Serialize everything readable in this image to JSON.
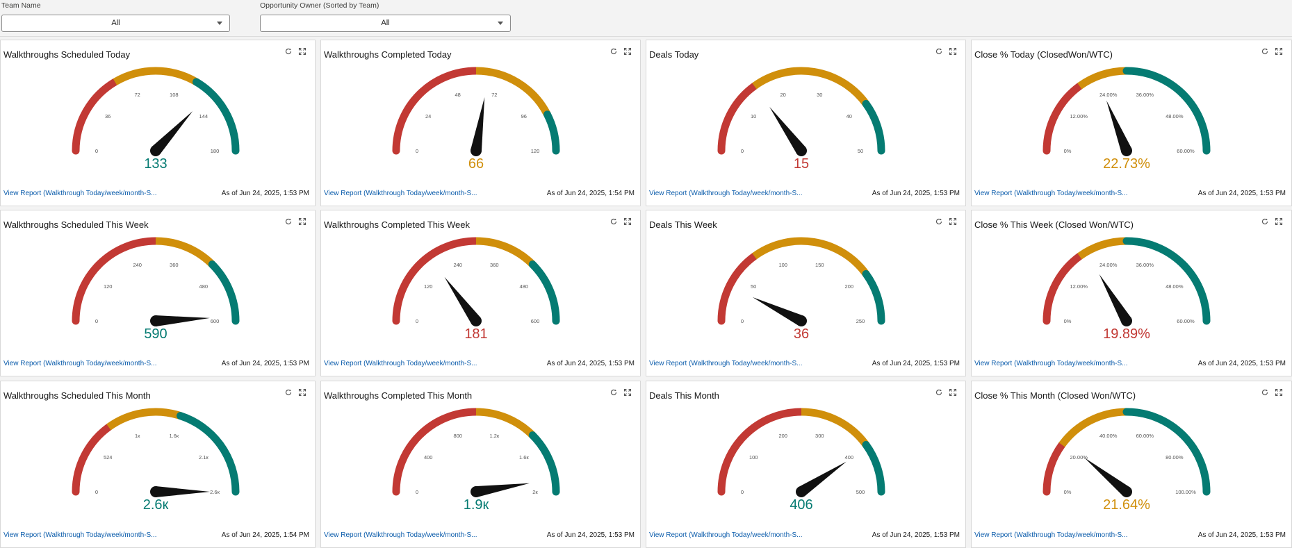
{
  "filters": [
    {
      "label": "Team Name",
      "value": "All"
    },
    {
      "label": "Opportunity Owner (Sorted by Team)",
      "value": "All"
    }
  ],
  "colors": {
    "red": "#c23934",
    "amber": "#d08f0b",
    "teal": "#057b72",
    "link": "#0b5cab"
  },
  "icons": {
    "refresh": "refresh-icon",
    "expand": "expand-icon"
  },
  "cards": [
    {
      "title": "Walkthroughs Scheduled Today",
      "value_label": "133",
      "value": 133,
      "min": 0,
      "max": 180,
      "ticks": [
        "0",
        "36",
        "72",
        "108",
        "144",
        "180"
      ],
      "breaks": [
        0.33,
        0.67
      ],
      "value_color": "#057b72",
      "link": "View Report (Walkthrough Today/week/month-S...",
      "asof": "As of Jun 24, 2025, 1:53 PM"
    },
    {
      "title": "Walkthroughs Completed Today",
      "value_label": "66",
      "value": 66,
      "min": 0,
      "max": 120,
      "ticks": [
        "0",
        "24",
        "48",
        "72",
        "96",
        "120"
      ],
      "breaks": [
        0.5,
        0.85
      ],
      "value_color": "#d08f0b",
      "link": "View Report (Walkthrough Today/week/month-S...",
      "asof": "As of Jun 24, 2025, 1:54 PM"
    },
    {
      "title": "Deals Today",
      "value_label": "15",
      "value": 15,
      "min": 0,
      "max": 50,
      "ticks": [
        "0",
        "10",
        "20",
        "30",
        "40",
        "50"
      ],
      "breaks": [
        0.3,
        0.8
      ],
      "value_color": "#c23934",
      "link": "View Report (Walkthrough Today/week/month-S...",
      "asof": "As of Jun 24, 2025, 1:53 PM"
    },
    {
      "title": "Close % Today (ClosedWon/WTC)",
      "value_label": "22.73%",
      "value": 22.73,
      "min": 0,
      "max": 60,
      "ticks": [
        "0%",
        "12.00%",
        "24.00%",
        "36.00%",
        "48.00%",
        "60.00%"
      ],
      "breaks": [
        0.3,
        0.5
      ],
      "value_color": "#d08f0b",
      "link": "View Report (Walkthrough Today/week/month-S...",
      "asof": "As of Jun 24, 2025, 1:53 PM"
    },
    {
      "title": "Walkthroughs Scheduled This Week",
      "value_label": "590",
      "value": 590,
      "min": 0,
      "max": 600,
      "ticks": [
        "0",
        "120",
        "240",
        "360",
        "480",
        "600"
      ],
      "breaks": [
        0.5,
        0.75
      ],
      "value_color": "#057b72",
      "link": "View Report (Walkthrough Today/week/month-S...",
      "asof": "As of Jun 24, 2025, 1:53 PM"
    },
    {
      "title": "Walkthroughs Completed This Week",
      "value_label": "181",
      "value": 181,
      "min": 0,
      "max": 600,
      "ticks": [
        "0",
        "120",
        "240",
        "360",
        "480",
        "600"
      ],
      "breaks": [
        0.5,
        0.75
      ],
      "value_color": "#c23934",
      "link": "View Report (Walkthrough Today/week/month-S...",
      "asof": "As of Jun 24, 2025, 1:53 PM"
    },
    {
      "title": "Deals This Week",
      "value_label": "36",
      "value": 36,
      "min": 0,
      "max": 250,
      "ticks": [
        "0",
        "50",
        "100",
        "150",
        "200",
        "250"
      ],
      "breaks": [
        0.3,
        0.8
      ],
      "value_color": "#c23934",
      "link": "View Report (Walkthrough Today/week/month-S...",
      "asof": "As of Jun 24, 2025, 1:53 PM"
    },
    {
      "title": "Close % This Week (Closed Won/WTC)",
      "value_label": "19.89%",
      "value": 19.89,
      "min": 0,
      "max": 60,
      "ticks": [
        "0%",
        "12.00%",
        "24.00%",
        "36.00%",
        "48.00%",
        "60.00%"
      ],
      "breaks": [
        0.3,
        0.5
      ],
      "value_color": "#c23934",
      "link": "View Report (Walkthrough Today/week/month-S...",
      "asof": "As of Jun 24, 2025, 1:53 PM"
    },
    {
      "title": "Walkthroughs Scheduled This Month",
      "value_label": "2.6к",
      "value": 2600,
      "min": 0,
      "max": 2600,
      "ticks": [
        "0",
        "524",
        "1к",
        "1.6к",
        "2.1к",
        "2.6к"
      ],
      "breaks": [
        0.3,
        0.6
      ],
      "value_color": "#057b72",
      "link": "View Report (Walkthrough Today/week/month-S...",
      "asof": "As of Jun 24, 2025, 1:54 PM"
    },
    {
      "title": "Walkthroughs Completed This Month",
      "value_label": "1.9к",
      "value": 1900,
      "min": 0,
      "max": 2000,
      "ticks": [
        "0",
        "400",
        "800",
        "1.2к",
        "1.6к",
        "2к"
      ],
      "breaks": [
        0.5,
        0.75
      ],
      "value_color": "#057b72",
      "link": "View Report (Walkthrough Today/week/month-S...",
      "asof": "As of Jun 24, 2025, 1:53 PM"
    },
    {
      "title": "Deals This Month",
      "value_label": "406",
      "value": 406,
      "min": 0,
      "max": 500,
      "ticks": [
        "0",
        "100",
        "200",
        "300",
        "400",
        "500"
      ],
      "breaks": [
        0.5,
        0.8
      ],
      "value_color": "#057b72",
      "link": "View Report (Walkthrough Today/week/month-S...",
      "asof": "As of Jun 24, 2025, 1:53 PM"
    },
    {
      "title": "Close % This Month (Closed Won/WTC)",
      "value_label": "21.64%",
      "value": 21.64,
      "min": 0,
      "max": 100,
      "ticks": [
        "0%",
        "20.00%",
        "40.00%",
        "60.00%",
        "80.00%",
        "100.00%"
      ],
      "breaks": [
        0.2,
        0.5
      ],
      "value_color": "#d08f0b",
      "link": "View Report (Walkthrough Today/week/month-S...",
      "asof": "As of Jun 24, 2025, 1:53 PM"
    }
  ]
}
